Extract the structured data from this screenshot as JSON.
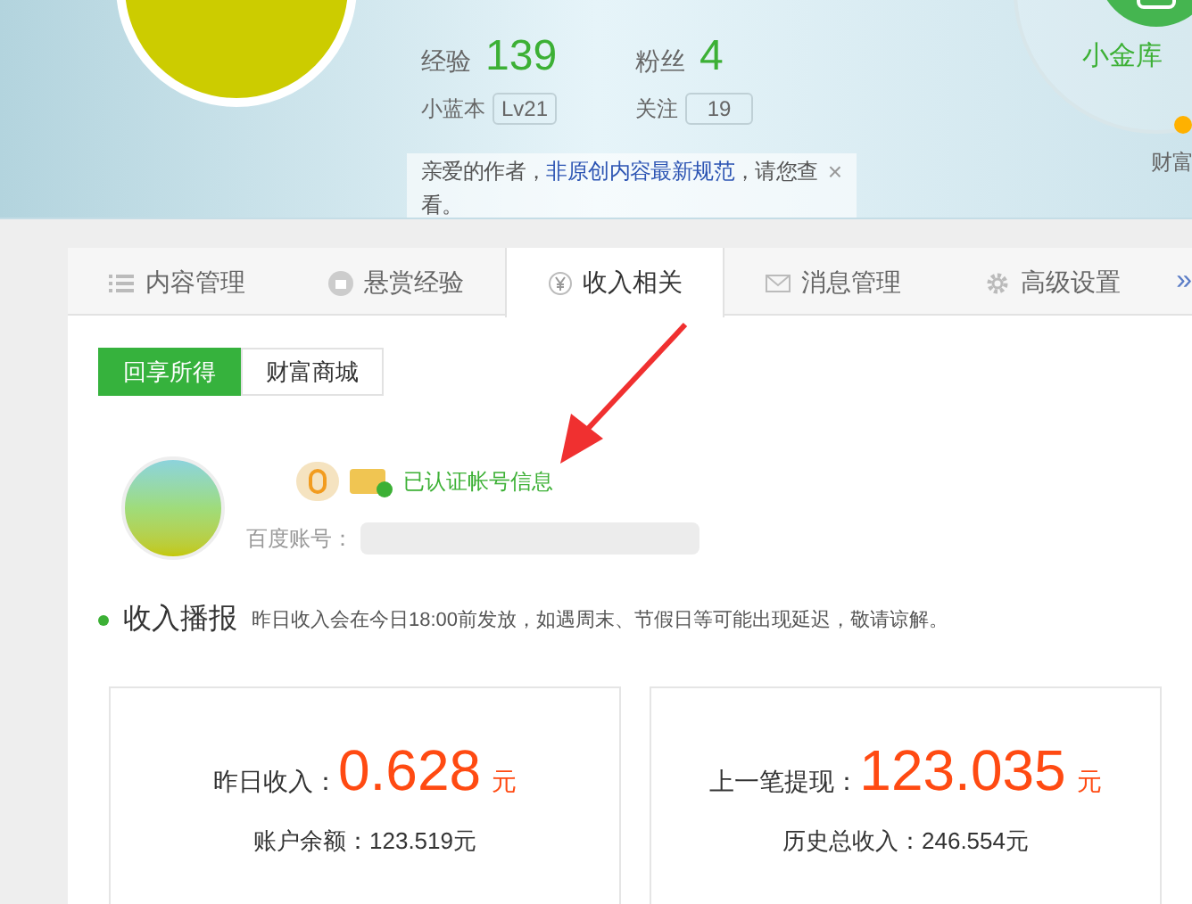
{
  "header": {
    "stats": [
      {
        "label": "经验",
        "value": "139"
      },
      {
        "label": "粉丝",
        "value": "4"
      }
    ],
    "badges": [
      {
        "label": "小蓝本",
        "value": "Lv21"
      },
      {
        "label": "关注",
        "value": "19"
      }
    ],
    "notice": {
      "before": "亲爱的作者，",
      "link": "非原创内容最新规范",
      "after": "，请您查看。",
      "close": "×"
    },
    "vault": {
      "label": "小金库"
    },
    "side_label": "财富"
  },
  "tabs": [
    {
      "label": "内容管理",
      "kind": "list",
      "selected": false
    },
    {
      "label": "悬赏经验",
      "kind": "reward",
      "selected": false
    },
    {
      "label": "收入相关",
      "kind": "yen",
      "selected": true
    },
    {
      "label": "消息管理",
      "kind": "mail",
      "selected": false
    },
    {
      "label": "高级设置",
      "kind": "gear",
      "selected": false
    }
  ],
  "tabs_more": "»",
  "subtabs": [
    {
      "label": "回享所得",
      "selected": true
    },
    {
      "label": "财富商城",
      "selected": false
    }
  ],
  "profile": {
    "verified": "已认证帐号信息",
    "account_label": "百度账号："
  },
  "section": {
    "title": "收入播报",
    "note": "昨日收入会在今日18:00前发放，如遇周末、节假日等可能出现延迟，敬请谅解。"
  },
  "cards": [
    {
      "label": "昨日收入：",
      "amount": "0.628",
      "unit": "元",
      "sub": "账户余额：123.519元"
    },
    {
      "label": "上一笔提现：",
      "amount": "123.035",
      "unit": "元",
      "sub": "历史总收入：246.554元"
    }
  ]
}
